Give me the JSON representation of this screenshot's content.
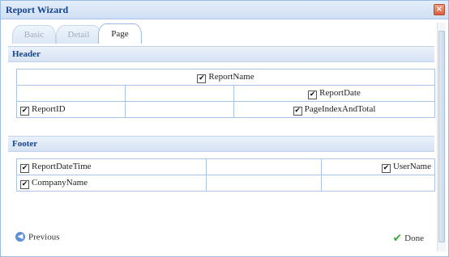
{
  "window": {
    "title": "Report Wizard"
  },
  "tabs": [
    {
      "label": "Basic",
      "active": false
    },
    {
      "label": "Detail",
      "active": false
    },
    {
      "label": "Page",
      "active": true
    }
  ],
  "header_section": {
    "title": "Header",
    "items": {
      "report_name": {
        "label": "ReportName",
        "checked": true
      },
      "report_date": {
        "label": "ReportDate",
        "checked": true
      },
      "report_id": {
        "label": "ReportID",
        "checked": true
      },
      "page_index": {
        "label": "PageIndexAndTotal",
        "checked": true
      }
    }
  },
  "footer_section": {
    "title": "Footer",
    "items": {
      "report_datetime": {
        "label": "ReportDateTime",
        "checked": true
      },
      "user_name": {
        "label": "UserName",
        "checked": true
      },
      "company_name": {
        "label": "CompanyName",
        "checked": true
      }
    }
  },
  "buttons": {
    "previous": "Previous",
    "done": "Done"
  },
  "icons": {
    "check_glyph": "✔",
    "prev_icon": "arrow-left-circle-icon",
    "done_icon": "checkmark-icon",
    "close_icon": "close-icon"
  },
  "colors": {
    "title_text": "#15428b",
    "border": "#99bbe8",
    "section_bg": "#d6e3f4",
    "close_button": "#d85f3f",
    "done_check": "#3fa83a"
  }
}
